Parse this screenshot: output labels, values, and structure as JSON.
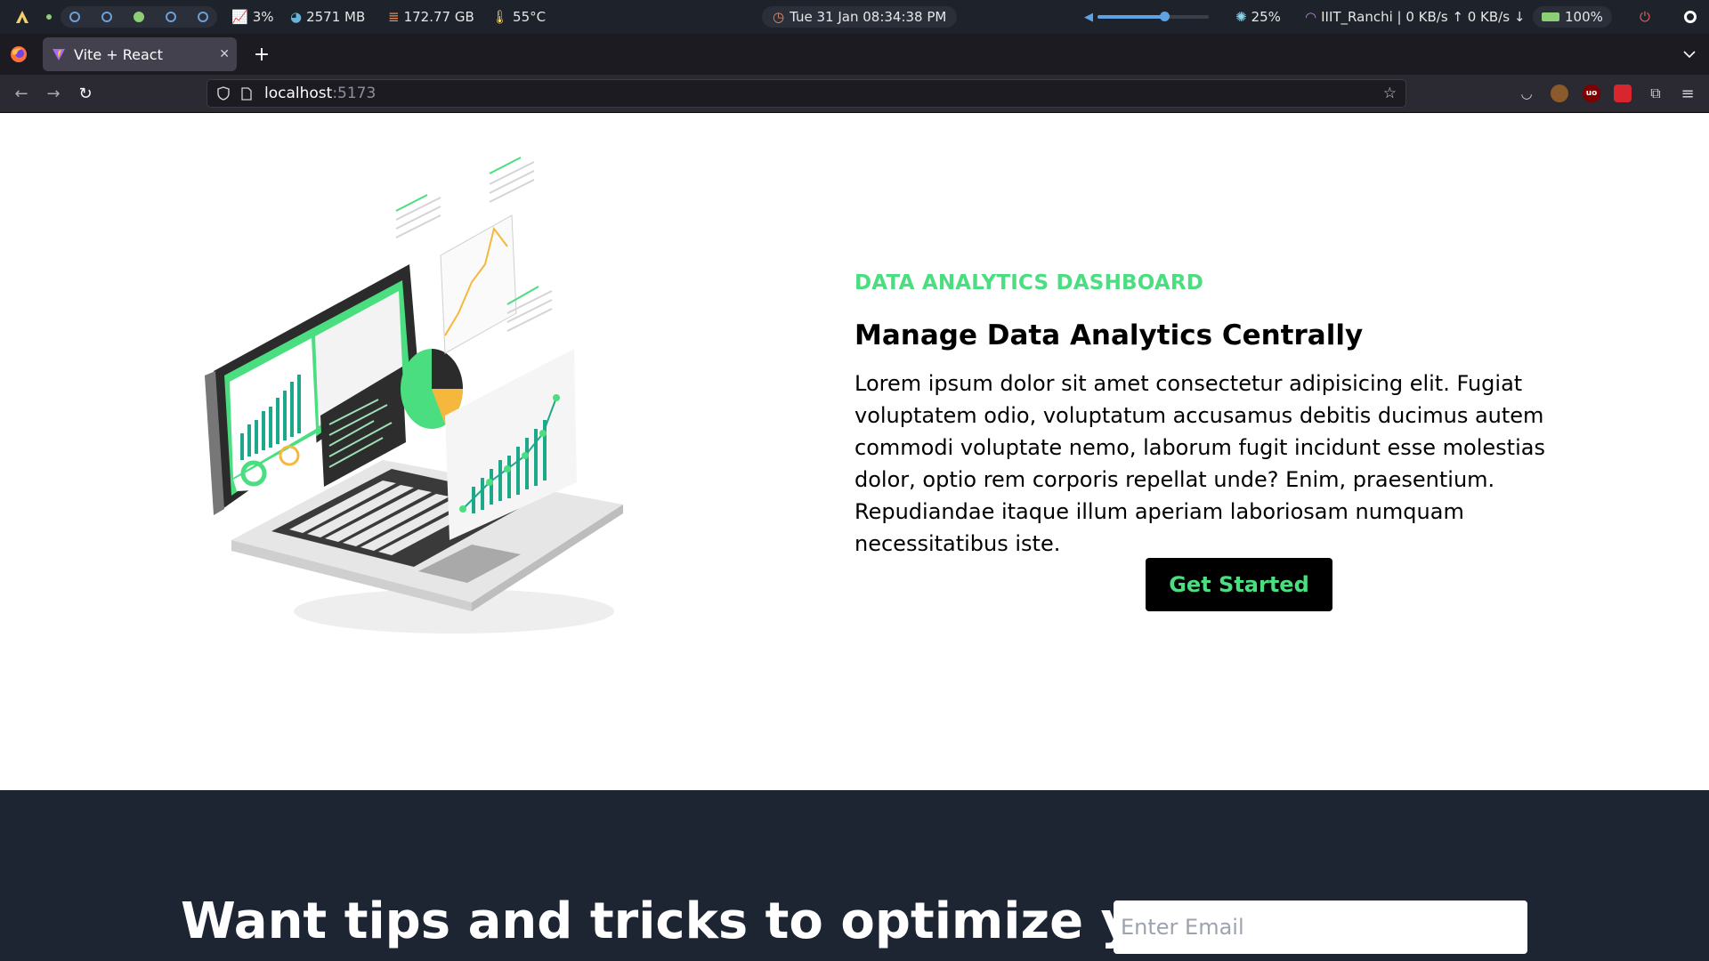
{
  "system_bar": {
    "cpu": "3%",
    "memory": "2571 MB",
    "disk": "172.77 GB",
    "temperature": "55°C",
    "datetime": "Tue 31 Jan 08:34:38 PM",
    "volume_level": 0.6,
    "brightness": "25%",
    "network": "IIIT_Ranchi | 0 KB/s ↑ 0 KB/s ↓",
    "battery": "100%",
    "workspaces": [
      false,
      false,
      true,
      false,
      false
    ]
  },
  "browser": {
    "tab_title": "Vite + React",
    "url_host": "localhost",
    "url_port": ":5173"
  },
  "hero": {
    "eyebrow": "DATA ANALYTICS DASHBOARD",
    "title": "Manage Data Analytics Centrally",
    "body": "Lorem ipsum dolor sit amet consectetur adipisicing elit. Fugiat voluptatem odio, voluptatum accusamus debitis ducimus autem commodi voluptate nemo, laborum fugit incidunt esse molestias dolor, optio rem corporis repellat unde? Enim, praesentium. Repudiandae itaque illum aperiam laboriosam numquam necessitatibus iste.",
    "cta_label": "Get Started"
  },
  "newsletter": {
    "title": "Want tips and tricks to optimize your",
    "email_placeholder": "Enter Email"
  },
  "colors": {
    "accent": "#4ade80",
    "dark_section": "#1e2532"
  }
}
